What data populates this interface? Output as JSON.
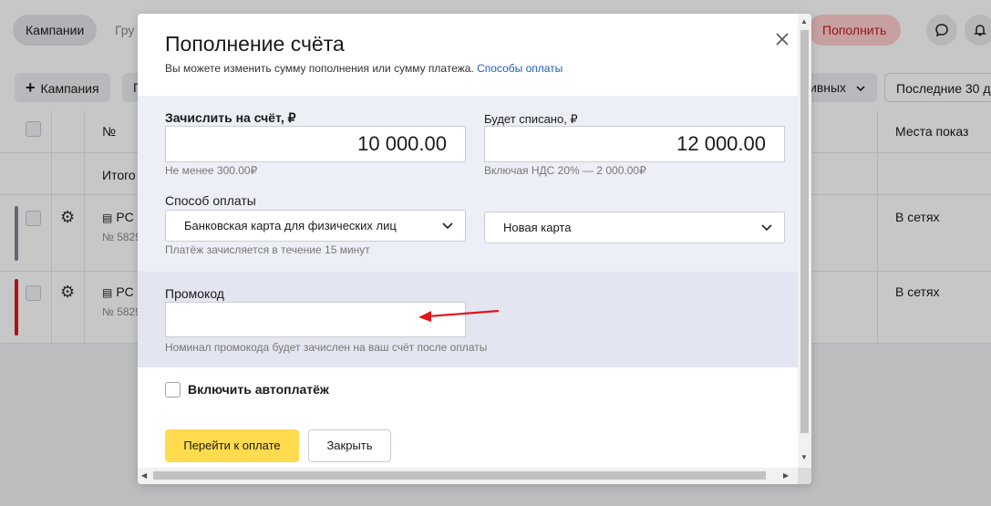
{
  "background": {
    "tabs": [
      "Кампании",
      "Гру"
    ],
    "topup_label": "Пополнить",
    "toolbar": {
      "add_campaign": "Кампания",
      "filter_short": "П",
      "effective_label": "ивных",
      "period_label": "Последние 30 д"
    },
    "table": {
      "header_number": "№",
      "header_placements": "Места показ",
      "total_label": "Итого",
      "rows": [
        {
          "name": "PC",
          "id": "№ 5829",
          "placement": "В сетях",
          "stripe_color": "#7e8590"
        },
        {
          "name": "PC",
          "id": "№ 5829",
          "placement": "В сетях",
          "stripe_color": "#e0151b"
        }
      ]
    }
  },
  "modal": {
    "title": "Пополнение счёта",
    "subtitle": "Вы можете изменить сумму пополнения или сумму платежа.",
    "payment_methods_link": "Способы оплаты",
    "credit": {
      "label": "Зачислить на счёт, ₽",
      "value": "10 000.00",
      "hint": "Не менее 300.00₽"
    },
    "charge": {
      "label": "Будет списано, ₽",
      "value": "12 000.00",
      "hint": "Включая НДС 20% — 2 000.00₽"
    },
    "payment_method": {
      "label": "Способ оплаты",
      "selected": "Банковская карта для физических лиц",
      "card": "Новая карта",
      "hint": "Платёж зачисляется в течение 15 минут"
    },
    "promo": {
      "label": "Промокод",
      "value": "",
      "hint": "Номинал промокода будет зачислен на ваш счёт после оплаты"
    },
    "autopay_label": "Включить автоплатёж",
    "pay_button": "Перейти к оплате",
    "close_button": "Закрыть"
  },
  "colors": {
    "accent_yellow": "#ffdb4d",
    "link_blue": "#1f5fb5",
    "annotation_arrow": "#e3141b",
    "topup_red": "#c21b1b"
  },
  "icons": [
    "close-icon",
    "chevron-down-icon",
    "plus-icon",
    "chat-icon",
    "bell-icon",
    "gear-icon",
    "campaign-list-icon",
    "arrow-annotation-icon"
  ]
}
